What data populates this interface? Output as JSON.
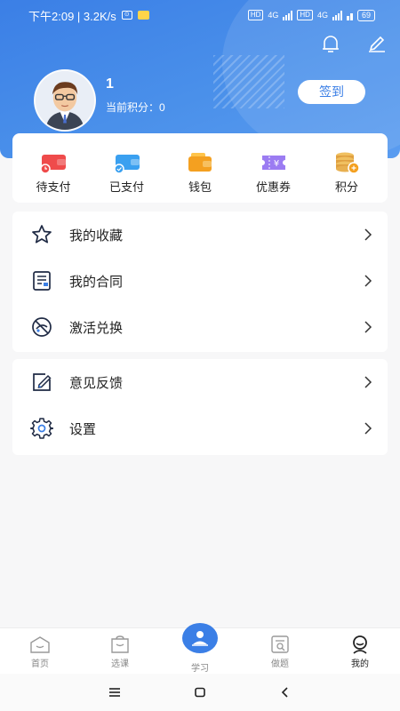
{
  "status_bar": {
    "time_speed": "下午2:09 | 3.2K/s",
    "hd1": "HD",
    "net1": "4G",
    "hd2": "HD",
    "net2": "4G",
    "battery": "69"
  },
  "header": {
    "user_name": "1",
    "points_text": "当前积分：0",
    "signin_label": "签到",
    "bell_icon": "bell-icon",
    "edit_icon": "edit-icon"
  },
  "orders": [
    {
      "label": "待支付",
      "icon": "pending-payment-icon",
      "color": "#ef4b4b"
    },
    {
      "label": "已支付",
      "icon": "paid-icon",
      "color": "#3aa0f0"
    },
    {
      "label": "钱包",
      "icon": "wallet-icon",
      "color": "#f4a020"
    },
    {
      "label": "优惠券",
      "icon": "coupon-icon",
      "color": "#8a6af0"
    },
    {
      "label": "积分",
      "icon": "points-icon",
      "color": "#e0a040"
    }
  ],
  "menu_group1": [
    {
      "label": "我的收藏",
      "icon": "star-icon"
    },
    {
      "label": "我的合同",
      "icon": "contract-icon"
    },
    {
      "label": "激活兑换",
      "icon": "activate-icon"
    }
  ],
  "menu_group2": [
    {
      "label": "意见反馈",
      "icon": "feedback-icon"
    },
    {
      "label": "设置",
      "icon": "settings-icon"
    }
  ],
  "tabs": [
    {
      "label": "首页",
      "icon": "home-icon"
    },
    {
      "label": "选课",
      "icon": "course-icon"
    },
    {
      "label": "学习",
      "icon": "study-icon"
    },
    {
      "label": "做题",
      "icon": "exercise-icon"
    },
    {
      "label": "我的",
      "icon": "profile-icon"
    }
  ],
  "colors": {
    "primary": "#3b7fe6",
    "background": "#f7f7f8"
  }
}
